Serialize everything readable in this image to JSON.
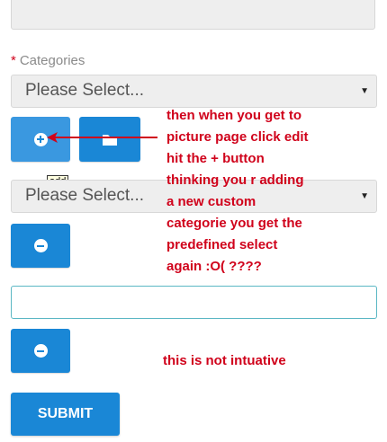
{
  "form": {
    "categories_label": "Categories",
    "required_marker": "*",
    "select_placeholder": "Please Select...",
    "tooltip_add": "add",
    "submit_label": "SUBMIT"
  },
  "annotations": {
    "note1_lines": [
      "then when you get to",
      "picture page click edit",
      "hit the + button",
      "thinking you r adding",
      "a new custom",
      "categorie you get the",
      "predefined select",
      "again :O( ????"
    ],
    "note2": "this is not intuative",
    "color": "#d0021b"
  },
  "colors": {
    "button_blue": "#1a87d6",
    "button_hover": "#3a98e0",
    "input_border": "#5bb7c4"
  }
}
